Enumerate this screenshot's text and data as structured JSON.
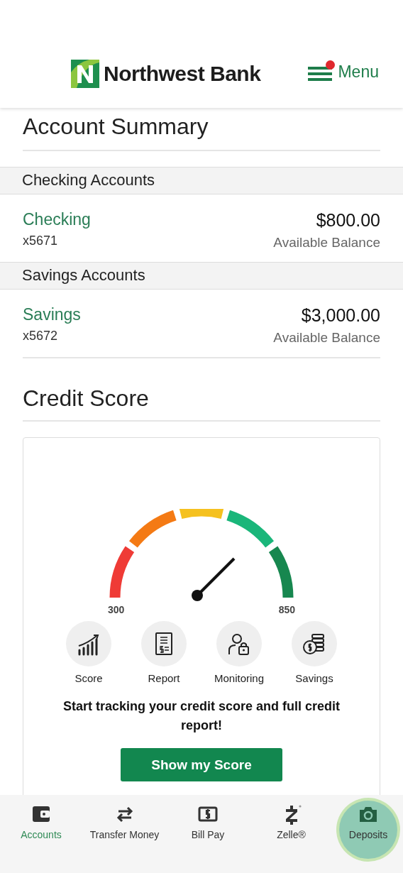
{
  "header": {
    "brand": "Northwest Bank",
    "menu": {
      "label": "Menu",
      "notification": true
    }
  },
  "title": "Account Summary",
  "sections": [
    {
      "heading": "Checking Accounts",
      "accounts": [
        {
          "name": "Checking",
          "number": "x5671",
          "amount": "$800.00",
          "caption": "Available Balance"
        }
      ]
    },
    {
      "heading": "Savings Accounts",
      "accounts": [
        {
          "name": "Savings",
          "number": "x5672",
          "amount": "$3,000.00",
          "caption": "Available Balance"
        }
      ]
    }
  ],
  "credit": {
    "title": "Credit Score",
    "min_label": "300",
    "max_label": "850",
    "features": [
      {
        "kind": "score",
        "label": "Score"
      },
      {
        "kind": "report",
        "label": "Report"
      },
      {
        "kind": "monitoring",
        "label": "Monitoring"
      },
      {
        "kind": "savings",
        "label": "Savings"
      }
    ],
    "message": "Start tracking your credit score and full credit report!",
    "button": "Show my Score"
  },
  "tabs": [
    {
      "kind": "accounts",
      "label": "Accounts",
      "selected": true,
      "pressed": false
    },
    {
      "kind": "transfer",
      "label": "Transfer Money",
      "selected": false,
      "pressed": false
    },
    {
      "kind": "billpay",
      "label": "Bill Pay",
      "selected": false,
      "pressed": false
    },
    {
      "kind": "zelle",
      "label": "Zelle®",
      "selected": false,
      "pressed": false
    },
    {
      "kind": "deposits",
      "label": "Deposits",
      "selected": false,
      "pressed": true
    }
  ]
}
